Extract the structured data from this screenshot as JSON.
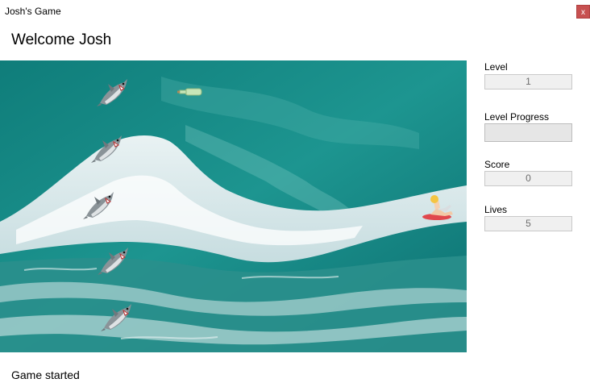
{
  "window": {
    "title": "Josh's Game",
    "close_label": "x"
  },
  "welcome_text": "Welcome Josh",
  "sidebar": {
    "level_label": "Level",
    "level_value": "1",
    "progress_label": "Level Progress",
    "progress_value": 0,
    "score_label": "Score",
    "score_value": "0",
    "lives_label": "Lives",
    "lives_value": "5"
  },
  "status_text": "Game started",
  "colors": {
    "close_button": "#c75050",
    "progress_fill": "#06b025",
    "water": "#1a8a86"
  },
  "game": {
    "sprites": [
      "shark-icon",
      "shark-icon",
      "shark-icon",
      "shark-icon",
      "shark-icon",
      "bottle-icon",
      "surfer-icon"
    ]
  }
}
